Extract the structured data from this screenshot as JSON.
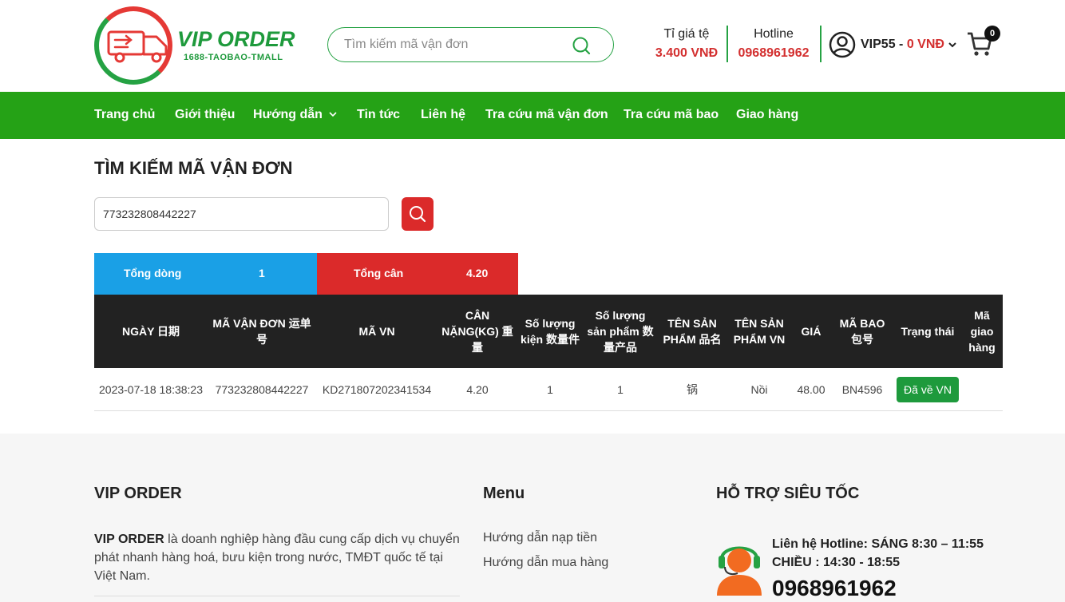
{
  "brand": {
    "name": "VIP ORDER",
    "tagline": "1688-TAOBAO-TMALL",
    "green": "#25a216",
    "red": "#db2a2a"
  },
  "header": {
    "search_placeholder": "Tìm kiếm mã vận đơn",
    "rate_label": "Tỉ giá tệ",
    "rate_value": "3.400 VNĐ",
    "hotline_label": "Hotline",
    "hotline_value": "0968961962",
    "account_name": "VIP55 -",
    "account_balance": "0 VNĐ",
    "cart_count": "0"
  },
  "nav": {
    "items": [
      "Trang chủ",
      "Giới thiệu",
      "Hướng dẫn",
      "Tin tức",
      "Liên hệ",
      "Tra cứu mã vận đơn",
      "Tra cứu mã bao",
      "Giao hàng"
    ]
  },
  "main": {
    "title": "TÌM KIẾM MÃ VẬN ĐƠN",
    "search_value": "773232808442227",
    "summary": {
      "rows_label": "Tổng dòng",
      "rows_value": "1",
      "weight_label": "Tổng cân",
      "weight_value": "4.20"
    },
    "table": {
      "headers": [
        "NGÀY 日期",
        "MÃ VẬN ĐƠN 运单号",
        "MÃ VN",
        "CÂN NẶNG(KG) 重量",
        "Số lượng kiện 数量件",
        "Số lượng sản phẩm 数量产品",
        "TÊN SẢN PHẨM 品名",
        "TÊN SẢN PHẨM VN",
        "GIÁ",
        "MÃ BAO 包号",
        "Trạng thái",
        "Mã giao hàng"
      ],
      "rows": [
        [
          "2023-07-18 18:38:23",
          "773232808442227",
          "KD271807202341534",
          "4.20",
          "1",
          "1",
          "锅",
          "Nồi",
          "48.00",
          "BN4596",
          "Đã về VN",
          ""
        ]
      ]
    }
  },
  "footer": {
    "about_title": "VIP ORDER",
    "about_brand": "VIP ORDER",
    "about_text": " là doanh nghiệp hàng đầu cung cấp dịch vụ chuyển phát nhanh hàng hoá, bưu kiện trong nước, TMĐT quốc tế tại Việt Nam.",
    "menu_title": "Menu",
    "menu_links": [
      "Hướng dẫn nạp tiền",
      "Hướng dẫn mua hàng"
    ],
    "support_title": "HỖ TRỢ SIÊU TỐC",
    "support_line1": "Liên hệ Hotline: SÁNG 8:30 – 11:55",
    "support_line2": "CHIỀU : 14:30 - 18:55",
    "support_phone": "0968961962"
  }
}
